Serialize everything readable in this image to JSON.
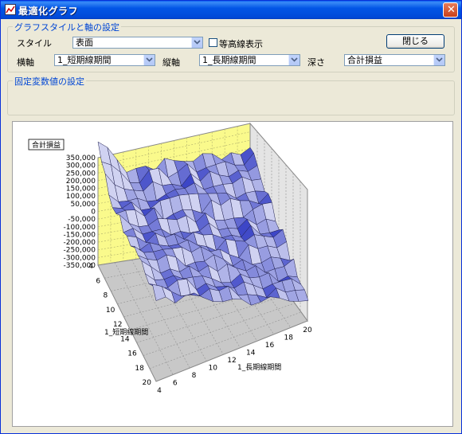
{
  "window": {
    "title": "最適化グラフ"
  },
  "graph_settings": {
    "legend": "グラフスタイルと軸の設定",
    "style_label": "スタイル",
    "style_value": "表面",
    "contour_label": "等高線表示",
    "contour_checked": false,
    "close_label": "閉じる",
    "x_axis_label": "横軸",
    "x_axis_value": "1_短期線期間",
    "y_axis_label": "縦軸",
    "y_axis_value": "1_長期線期間",
    "depth_label": "深さ",
    "depth_value": "合計損益"
  },
  "fixed_vars": {
    "legend": "固定変数値の設定"
  },
  "chart_data": {
    "type": "surface",
    "z_label": "合計損益",
    "x_label": "1_長期線期間",
    "y_label": "1_短期線期間",
    "z_ticks": [
      "350,000",
      "300,000",
      "250,000",
      "200,000",
      "150,000",
      "100,000",
      "50,000",
      "0",
      "-50,000",
      "-100,000",
      "-150,000",
      "-200,000",
      "-250,000",
      "-300,000",
      "-350,000"
    ],
    "x_ticks": [
      "4",
      "6",
      "8",
      "10",
      "12",
      "14",
      "16",
      "18",
      "20"
    ],
    "y_ticks": [
      "4",
      "6",
      "8",
      "10",
      "12",
      "14",
      "16",
      "18",
      "20"
    ],
    "zlim": [
      -350000,
      350000
    ],
    "surface_color": "#8c94e6",
    "back_wall_color": "#fafa8c",
    "floor_color": "#c8c8c8"
  }
}
